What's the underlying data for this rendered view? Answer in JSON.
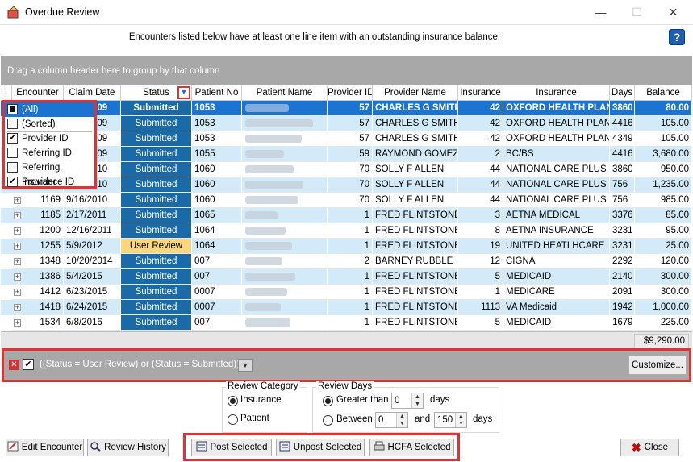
{
  "window": {
    "title": "Overdue Review",
    "minimize": "—",
    "maximize": "☐",
    "close": "✕"
  },
  "info": {
    "message": "Encounters listed below have at least one line item with an outstanding insurance balance.",
    "help": "?"
  },
  "groupbar": {
    "text": "Drag a column header here to group by that column"
  },
  "columns": [
    "Encounter",
    "Claim Date",
    "Status",
    "Patient No",
    "Patient Name",
    "Provider ID",
    "Provider Name",
    "Insurance",
    "Insurance",
    "Days",
    "Balance"
  ],
  "rows": [
    {
      "encounter": "1169",
      "date": "2/19/2009",
      "status": "Submitted",
      "patient_no": "1053",
      "provider_id": "57",
      "provider_name": "CHARLES G SMITH",
      "ins_id": "42",
      "insurance": "OXFORD HEALTH PLANS",
      "days": "3860",
      "balance": "80.00"
    },
    {
      "encounter": "1169",
      "date": "2/19/2009",
      "status": "Submitted",
      "patient_no": "1053",
      "provider_id": "57",
      "provider_name": "CHARLES G SMITH",
      "ins_id": "42",
      "insurance": "OXFORD HEALTH PLANS",
      "days": "4416",
      "balance": "105.00"
    },
    {
      "encounter": "1169",
      "date": "2/19/2009",
      "status": "Submitted",
      "patient_no": "1053",
      "provider_id": "57",
      "provider_name": "CHARLES G SMITH",
      "ins_id": "42",
      "insurance": "OXFORD HEALTH PLANS",
      "days": "4349",
      "balance": "105.00"
    },
    {
      "encounter": "1169",
      "date": "2/19/2009",
      "status": "Submitted",
      "patient_no": "1055",
      "provider_id": "59",
      "provider_name": "RAYMOND GOMEZ",
      "ins_id": "2",
      "insurance": "BC/BS",
      "days": "4416",
      "balance": "3,680.00"
    },
    {
      "encounter": "1169",
      "date": "9/16/2010",
      "status": "Submitted",
      "patient_no": "1060",
      "provider_id": "70",
      "provider_name": "SOLLY F ALLEN",
      "ins_id": "44",
      "insurance": "NATIONAL CARE PLUS",
      "days": "3860",
      "balance": "950.00"
    },
    {
      "encounter": "1169",
      "date": "9/16/2010",
      "status": "Submitted",
      "patient_no": "1060",
      "provider_id": "70",
      "provider_name": "SOLLY F ALLEN",
      "ins_id": "44",
      "insurance": "NATIONAL CARE PLUS",
      "days": "756",
      "balance": "1,235.00"
    },
    {
      "encounter": "1169",
      "date": "9/16/2010",
      "status": "Submitted",
      "patient_no": "1060",
      "provider_id": "70",
      "provider_name": "SOLLY F ALLEN",
      "ins_id": "44",
      "insurance": "NATIONAL CARE PLUS",
      "days": "756",
      "balance": "985.00"
    },
    {
      "encounter": "1185",
      "date": "2/17/2011",
      "status": "Submitted",
      "patient_no": "1065",
      "provider_id": "1",
      "provider_name": "FRED FLINTSTONE",
      "ins_id": "3",
      "insurance": "AETNA MEDICAL",
      "days": "3376",
      "balance": "85.00"
    },
    {
      "encounter": "1200",
      "date": "12/16/2011",
      "status": "Submitted",
      "patient_no": "1064",
      "provider_id": "1",
      "provider_name": "FRED FLINTSTONE",
      "ins_id": "8",
      "insurance": "AETNA INSURANCE",
      "days": "3231",
      "balance": "95.00"
    },
    {
      "encounter": "1255",
      "date": "5/9/2012",
      "status": "User Review",
      "patient_no": "1064",
      "provider_id": "1",
      "provider_name": "FRED FLINTSTONE",
      "ins_id": "19",
      "insurance": "UNITED HEATLHCARE",
      "days": "3231",
      "balance": "25.00"
    },
    {
      "encounter": "1348",
      "date": "10/20/2014",
      "status": "Submitted",
      "patient_no": "007",
      "provider_id": "2",
      "provider_name": "BARNEY RUBBLE",
      "ins_id": "12",
      "insurance": "CIGNA",
      "days": "2292",
      "balance": "120.00"
    },
    {
      "encounter": "1386",
      "date": "5/4/2015",
      "status": "Submitted",
      "patient_no": "007",
      "provider_id": "1",
      "provider_name": "FRED FLINTSTONE",
      "ins_id": "5",
      "insurance": "MEDICAID",
      "days": "2140",
      "balance": "300.00"
    },
    {
      "encounter": "1412",
      "date": "6/23/2015",
      "status": "Submitted",
      "patient_no": "0007",
      "provider_id": "1",
      "provider_name": "FRED FLINTSTONE",
      "ins_id": "1",
      "insurance": "MEDICARE",
      "days": "2091",
      "balance": "300.00"
    },
    {
      "encounter": "1418",
      "date": "6/24/2015",
      "status": "Submitted",
      "patient_no": "0007",
      "provider_id": "1",
      "provider_name": "FRED FLINTSTONE",
      "ins_id": "1113",
      "insurance": "VA Medicaid",
      "days": "1942",
      "balance": "1,000.00"
    },
    {
      "encounter": "1534",
      "date": "6/8/2016",
      "status": "Submitted",
      "patient_no": "007",
      "provider_id": "1",
      "provider_name": "FRED FLINTSTONE",
      "ins_id": "5",
      "insurance": "MEDICAID",
      "days": "1679",
      "balance": "225.00"
    }
  ],
  "total": "$9,290.00",
  "dropdown": [
    {
      "label": "(All)",
      "checked": false
    },
    {
      "label": "(Sorted)",
      "checked": false
    },
    {
      "label": "Provider ID",
      "checked": true
    },
    {
      "label": "Referring ID",
      "checked": false
    },
    {
      "label": "Referring Provider",
      "checked": false
    },
    {
      "label": "Insurance ID",
      "checked": true
    }
  ],
  "filter": {
    "text": "((Status = User Review) or (Status = Submitted))",
    "customize": "Customize..."
  },
  "review_category": {
    "title": "Review Category",
    "insurance": "Insurance",
    "patient": "Patient"
  },
  "review_days": {
    "title": "Review Days",
    "greater_than": "Greater than",
    "greater_value": "0",
    "days1": "days",
    "between": "Between",
    "between_from": "0",
    "and": "and",
    "between_to": "150",
    "days2": "days"
  },
  "buttons": {
    "edit": "Edit Encounter",
    "history": "Review History",
    "post": "Post Selected",
    "unpost": "Unpost Selected",
    "hcfa": "HCFA Selected",
    "close": "Close"
  },
  "colors": {
    "selected_row": "#1b74d2",
    "status_submitted": "#1a6aa8",
    "status_user_review": "#fad67e",
    "row_alt": "#d3ebf8",
    "highlight": "#e03232"
  }
}
